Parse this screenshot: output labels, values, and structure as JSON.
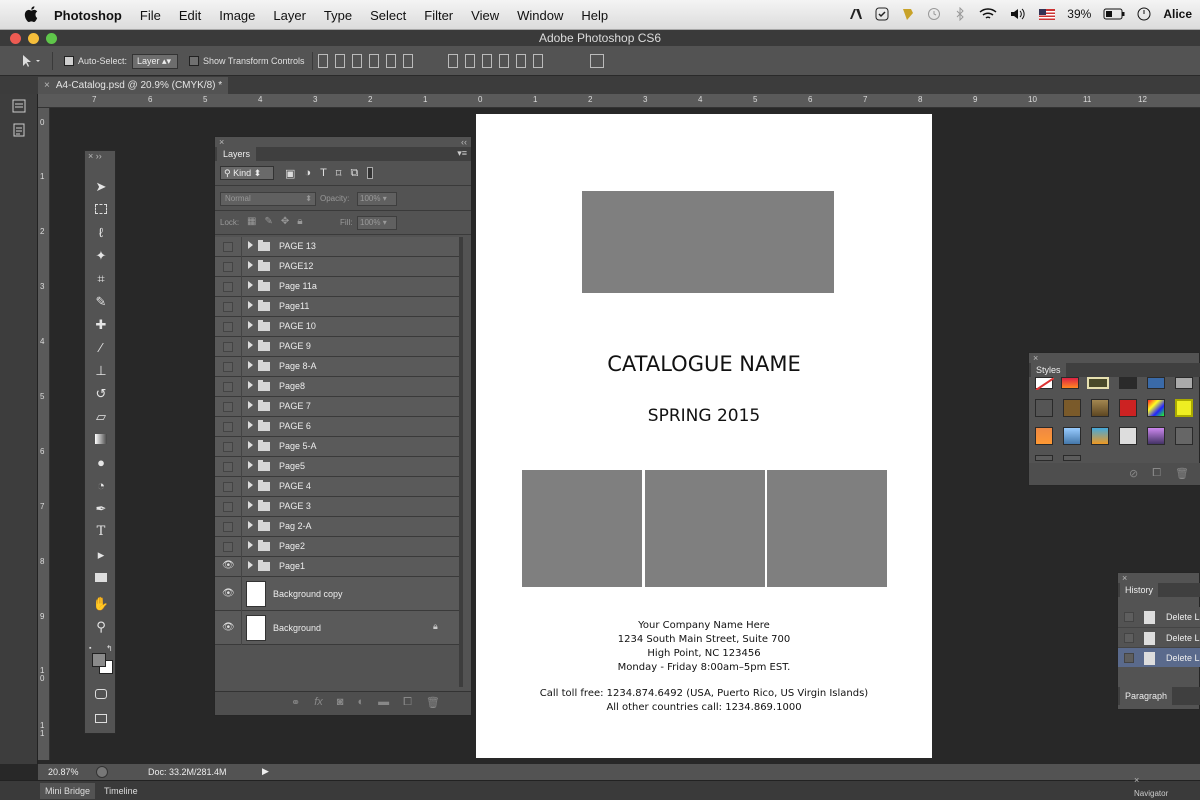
{
  "menubar": {
    "app_name": "Photoshop",
    "menus": [
      "File",
      "Edit",
      "Image",
      "Layer",
      "Type",
      "Select",
      "Filter",
      "View",
      "Window",
      "Help"
    ],
    "battery": "39%",
    "user": "Alice"
  },
  "window": {
    "title": "Adobe Photoshop CS6"
  },
  "options": {
    "auto_select_label": "Auto-Select:",
    "auto_select_value": "Layer",
    "transform_label": "Show Transform Controls"
  },
  "document": {
    "tab_label": "A4-Catalog.psd @ 20.9% (CMYK/8) *"
  },
  "rulers": {
    "h_labels": [
      "7",
      "6",
      "5",
      "4",
      "3",
      "2",
      "1",
      "0",
      "1",
      "2",
      "3",
      "4",
      "5",
      "6",
      "7",
      "8",
      "9",
      "10",
      "11",
      "12"
    ],
    "v_labels": [
      "0",
      "1",
      "2",
      "3",
      "4",
      "5",
      "6",
      "7",
      "8",
      "9",
      "1 0",
      "1 1"
    ]
  },
  "layers_panel": {
    "title": "Layers",
    "filter_label": "Kind",
    "blend_mode": "Normal",
    "opacity_label": "Opacity:",
    "opacity_value": "100%",
    "lock_label": "Lock:",
    "fill_label": "Fill:",
    "fill_value": "100%",
    "groups": [
      "PAGE 13",
      "PAGE12",
      "Page 11a",
      "Page11",
      "PAGE 10",
      "PAGE 9",
      "Page 8-A",
      "Page8",
      "PAGE 7",
      "PAGE 6",
      "Page 5-A",
      "Page5",
      "PAGE 4",
      "PAGE 3",
      "Pag 2-A",
      "Page2",
      "Page1"
    ],
    "layers": [
      "Background copy",
      "Background"
    ]
  },
  "canvas": {
    "title": "CATALOGUE NAME",
    "subtitle": "SPRING 2015",
    "company": "Your Company Name Here",
    "address1": "1234 South Main Street, Suite 700",
    "address2": "High Point, NC 123456",
    "hours": "Monday - Friday 8:00am–5pm EST.",
    "tollfree": "Call toll free: 1234.874.6492 (USA, Puerto Rico, US Virgin Islands)",
    "other": "All other countries call: 1234.869.1000"
  },
  "styles_panel": {
    "title": "Styles"
  },
  "history_panel": {
    "title": "History",
    "items": [
      "Delete L",
      "Delete L",
      "Delete L"
    ],
    "paragraph_tab": "Paragraph"
  },
  "status": {
    "zoom": "20.87%",
    "doc_size": "Doc: 33.2M/281.4M"
  },
  "bottom_tabs": [
    "Mini Bridge",
    "Timeline"
  ],
  "navigator_tab": "Navigator"
}
